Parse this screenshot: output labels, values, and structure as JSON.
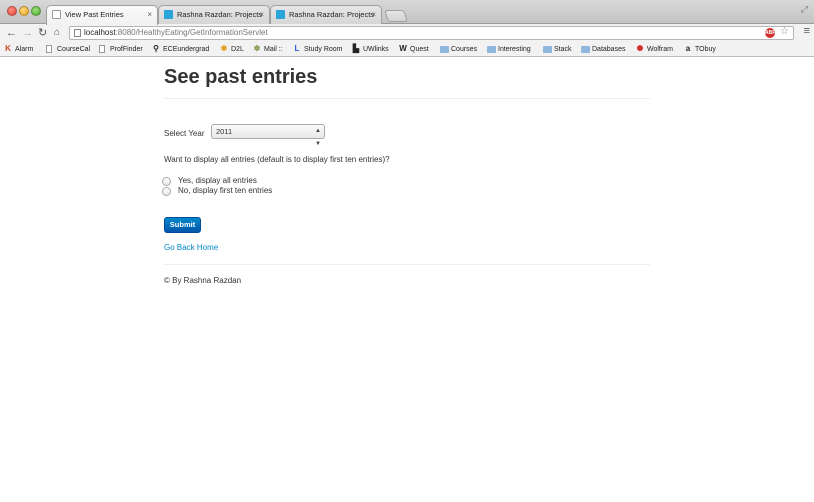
{
  "browser": {
    "tabs": [
      {
        "title": "View Past Entries",
        "close": "×"
      },
      {
        "title": "Rashna Razdan: Projects",
        "close": "×"
      },
      {
        "title": "Rashna Razdan: Projects",
        "close": "×"
      }
    ],
    "url_host": "localhost",
    "url_rest": ":8080/HealthyEating/GetInformationServlet",
    "bookmarks": [
      {
        "label": "Alarm",
        "icon": "K"
      },
      {
        "label": "CourseCal",
        "icon": "page"
      },
      {
        "label": "ProfFinder",
        "icon": "page"
      },
      {
        "label": "ECEundergrad",
        "icon": "⚲"
      },
      {
        "label": "D2L",
        "icon": "✱"
      },
      {
        "label": "Mail ::",
        "icon": "✲"
      },
      {
        "label": "Study Room",
        "icon": "L"
      },
      {
        "label": "UWlinks",
        "icon": "▙"
      },
      {
        "label": "Quest",
        "icon": "W"
      },
      {
        "label": "Courses",
        "icon": "folder"
      },
      {
        "label": "Interesting",
        "icon": "folder"
      },
      {
        "label": "Stack",
        "icon": "folder"
      },
      {
        "label": "Databases",
        "icon": "folder"
      },
      {
        "label": "Wolfram",
        "icon": "✺"
      },
      {
        "label": "TObuy",
        "icon": "a"
      }
    ]
  },
  "page": {
    "title": "See past entries",
    "select_year_label": "Select Year",
    "year_value": "2011",
    "question": "Want to display all entries (default is to display first ten entries)?",
    "options": [
      "Yes, display all entries",
      "No, display first ten entries"
    ],
    "submit_label": "Submit",
    "back_link": "Go Back Home",
    "footer": "© By Rashna Razdan"
  },
  "colors": {
    "primary_button": "#0070c0",
    "link": "#0088cc",
    "text": "#333333"
  }
}
